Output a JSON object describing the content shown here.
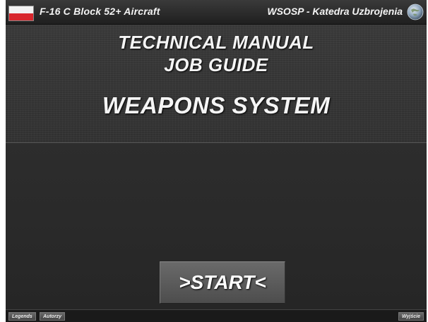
{
  "window": {
    "title_left": "F-16 C Block 52+ Aircraft",
    "title_right": "WSOSP - Katedra Uzbrojenia",
    "flag_icon": "poland-flag-icon",
    "logo_icon": "globe-emblem-icon"
  },
  "header": {
    "line1": "TECHNICAL MANUAL",
    "line2": "JOB GUIDE",
    "system_title": "WEAPONS SYSTEM"
  },
  "main": {
    "start_label": ">START<"
  },
  "footer": {
    "legends_label": "Legends",
    "authors_label": "Autorzy",
    "exit_label": "Wyjście"
  },
  "colors": {
    "background": "#2e2e2e",
    "text": "#f5f5f5",
    "flag_red": "#d8262c",
    "flag_white": "#f2f2f2"
  }
}
